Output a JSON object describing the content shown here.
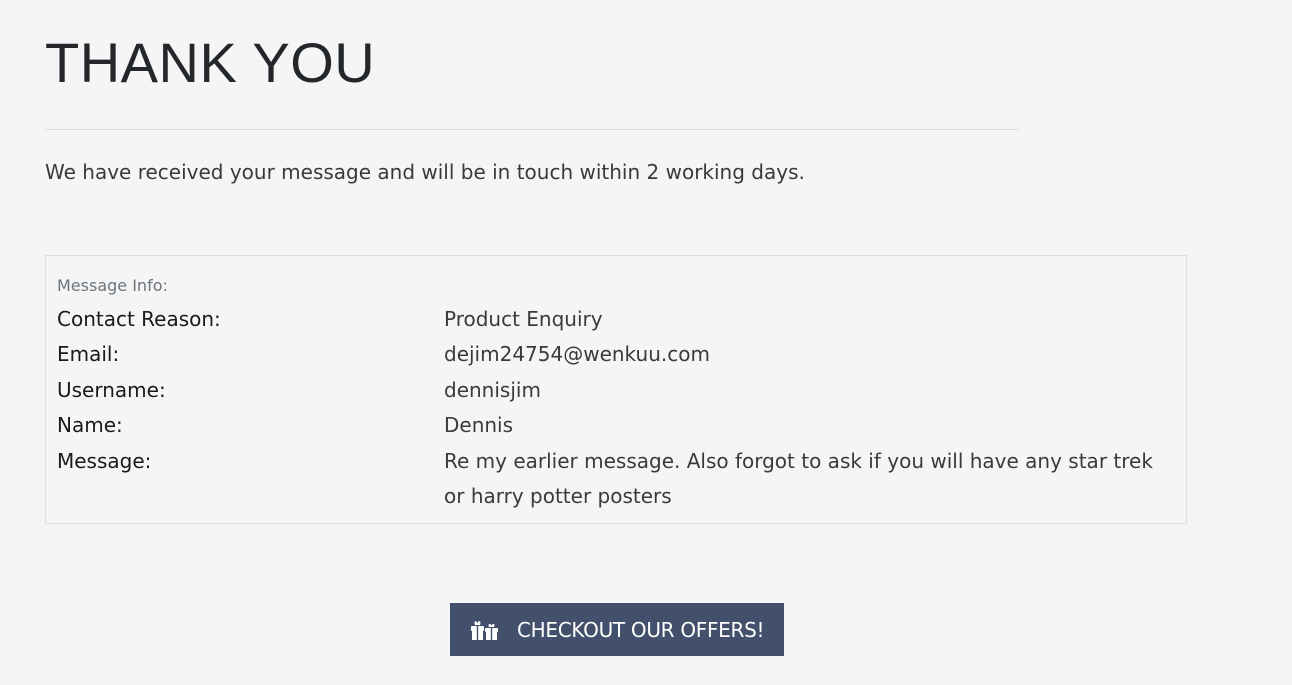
{
  "header": {
    "title": "THANK YOU",
    "intro": "We have received your message and will be in touch within 2 working days."
  },
  "message_info": {
    "heading": "Message Info:",
    "rows": [
      {
        "label": "Contact Reason:",
        "value": "Product Enquiry"
      },
      {
        "label": "Email:",
        "value": "dejim24754@wenkuu.com"
      },
      {
        "label": "Username:",
        "value": "dennisjim"
      },
      {
        "label": "Name:",
        "value": "Dennis"
      },
      {
        "label": "Message:",
        "value": "Re my earlier message. Also forgot to ask if you will have any star trek or harry potter posters"
      }
    ]
  },
  "cta": {
    "label": "CHECKOUT OUR OFFERS!",
    "icon": "gift-icon",
    "color": "#42506b"
  }
}
